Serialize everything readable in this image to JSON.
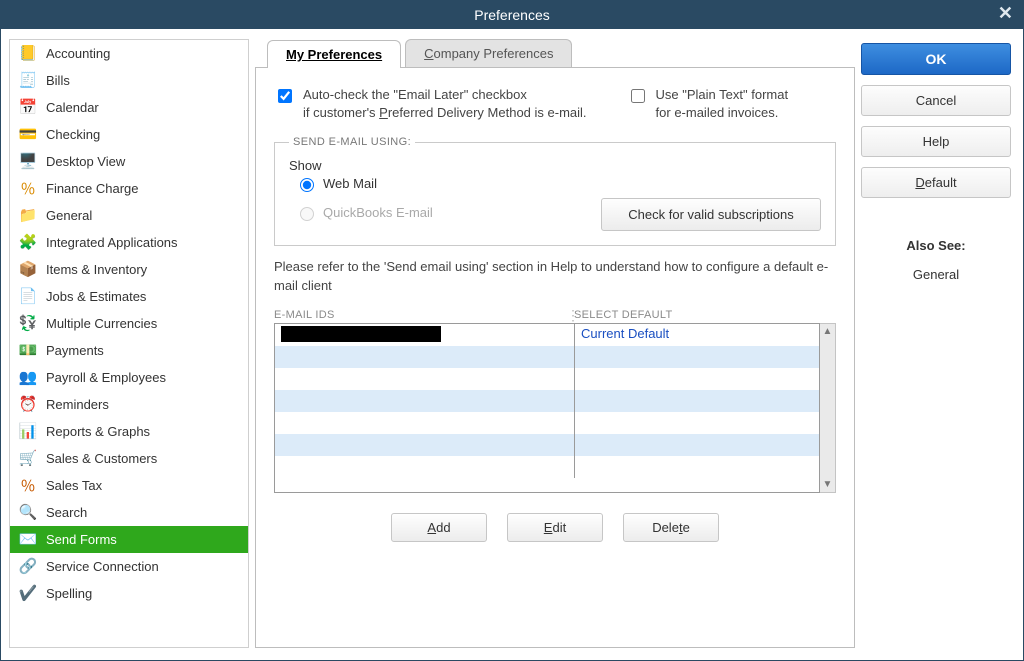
{
  "window": {
    "title": "Preferences"
  },
  "sidebar": {
    "items": [
      {
        "label": "Accounting",
        "icon": "📒",
        "color": "#d9a400"
      },
      {
        "label": "Bills",
        "icon": "🧾",
        "color": "#3b77c4"
      },
      {
        "label": "Calendar",
        "icon": "📅",
        "color": "#3b77c4"
      },
      {
        "label": "Checking",
        "icon": "💳",
        "color": "#4a9a3a"
      },
      {
        "label": "Desktop View",
        "icon": "🖥️",
        "color": "#3b77c4"
      },
      {
        "label": "Finance Charge",
        "icon": "％",
        "color": "#d98a00"
      },
      {
        "label": "General",
        "icon": "📁",
        "color": "#d9a400"
      },
      {
        "label": "Integrated Applications",
        "icon": "🧩",
        "color": "#7a5a2a"
      },
      {
        "label": "Items & Inventory",
        "icon": "📦",
        "color": "#c77a00"
      },
      {
        "label": "Jobs & Estimates",
        "icon": "📄",
        "color": "#d98a00"
      },
      {
        "label": "Multiple Currencies",
        "icon": "💱",
        "color": "#3a9a4a"
      },
      {
        "label": "Payments",
        "icon": "💵",
        "color": "#3a9a4a"
      },
      {
        "label": "Payroll & Employees",
        "icon": "👥",
        "color": "#6a4aa0"
      },
      {
        "label": "Reminders",
        "icon": "⏰",
        "color": "#d98a00"
      },
      {
        "label": "Reports & Graphs",
        "icon": "📊",
        "color": "#3a9a4a"
      },
      {
        "label": "Sales & Customers",
        "icon": "🛒",
        "color": "#c75a00"
      },
      {
        "label": "Sales Tax",
        "icon": "％",
        "color": "#c75a00"
      },
      {
        "label": "Search",
        "icon": "🔍",
        "color": "#555"
      },
      {
        "label": "Send Forms",
        "icon": "✉️",
        "color": "#fff",
        "selected": true
      },
      {
        "label": "Service Connection",
        "icon": "🔗",
        "color": "#555"
      },
      {
        "label": "Spelling",
        "icon": "✔️",
        "color": "#3b77c4"
      }
    ]
  },
  "tabs": {
    "my_prefs": "My Preferences",
    "company_prefs": "Company Preferences"
  },
  "options": {
    "auto_check_line1": "Auto-check the \"Email Later\" checkbox",
    "auto_check_line2_a": "if customer's ",
    "auto_check_line2_u": "P",
    "auto_check_line2_b": "referred Delivery Method is e-mail.",
    "auto_check_checked": true,
    "plain_text_line1": "Use \"Plain Text\" format",
    "plain_text_line2": "for e-mailed invoices.",
    "plain_text_checked": false
  },
  "sendmail": {
    "legend": "SEND E-MAIL USING:",
    "show_label_u": "S",
    "show_label_rest": "how",
    "webmail_u": "W",
    "webmail_rest": "eb Mail",
    "webmail_selected": true,
    "qb_email_label": "QuickBooks E-mail",
    "check_subs_btn": "Check for valid subscriptions",
    "help_text": "Please refer to the 'Send email using' section in Help to understand how to configure a default e-mail client"
  },
  "table": {
    "col1": "E-MAIL IDS",
    "col2": "SELECT DEFAULT",
    "rows": [
      {
        "id": "[redacted]",
        "default": "Current Default"
      },
      {
        "id": "",
        "default": ""
      },
      {
        "id": "",
        "default": ""
      },
      {
        "id": "",
        "default": ""
      },
      {
        "id": "",
        "default": ""
      },
      {
        "id": "",
        "default": ""
      },
      {
        "id": "",
        "default": ""
      }
    ]
  },
  "actions": {
    "add": "Add",
    "edit": "Edit",
    "delete": "Delete"
  },
  "right": {
    "ok": "OK",
    "cancel": "Cancel",
    "help": "Help",
    "default_u": "D",
    "default_rest": "efault",
    "also_see": "Also See:",
    "general": "General"
  }
}
